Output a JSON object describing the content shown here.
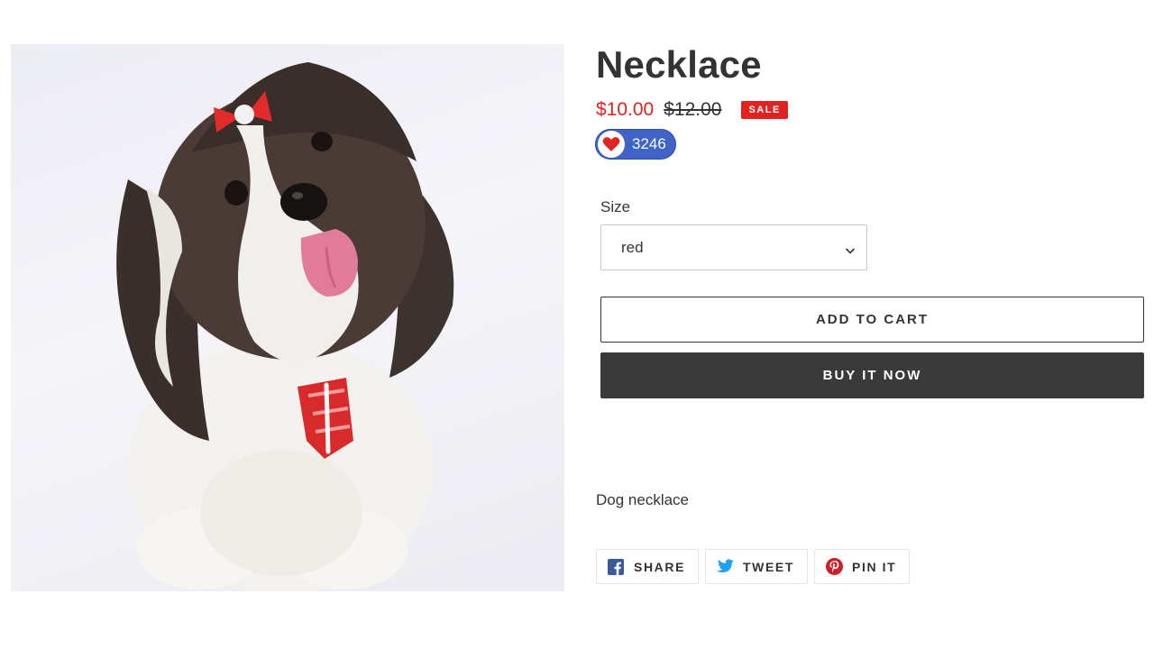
{
  "product": {
    "title": "Necklace",
    "sale_price": "$10.00",
    "compare_price": "$12.00",
    "sale_badge": "SALE",
    "likes": "3246",
    "size_label": "Size",
    "size_selected": "red",
    "add_to_cart_label": "ADD TO CART",
    "buy_now_label": "BUY IT NOW",
    "description": "Dog necklace"
  },
  "share": [
    {
      "label": "SHARE",
      "icon": "facebook-icon",
      "color": "#3b5998"
    },
    {
      "label": "TWEET",
      "icon": "twitter-icon",
      "color": "#1da1f2"
    },
    {
      "label": "PIN IT",
      "icon": "pinterest-icon",
      "color": "#cb2027"
    }
  ],
  "colors": {
    "sale": "#e22120",
    "like_pill": "#3f63c7",
    "buy_button": "#3a3a3a"
  }
}
